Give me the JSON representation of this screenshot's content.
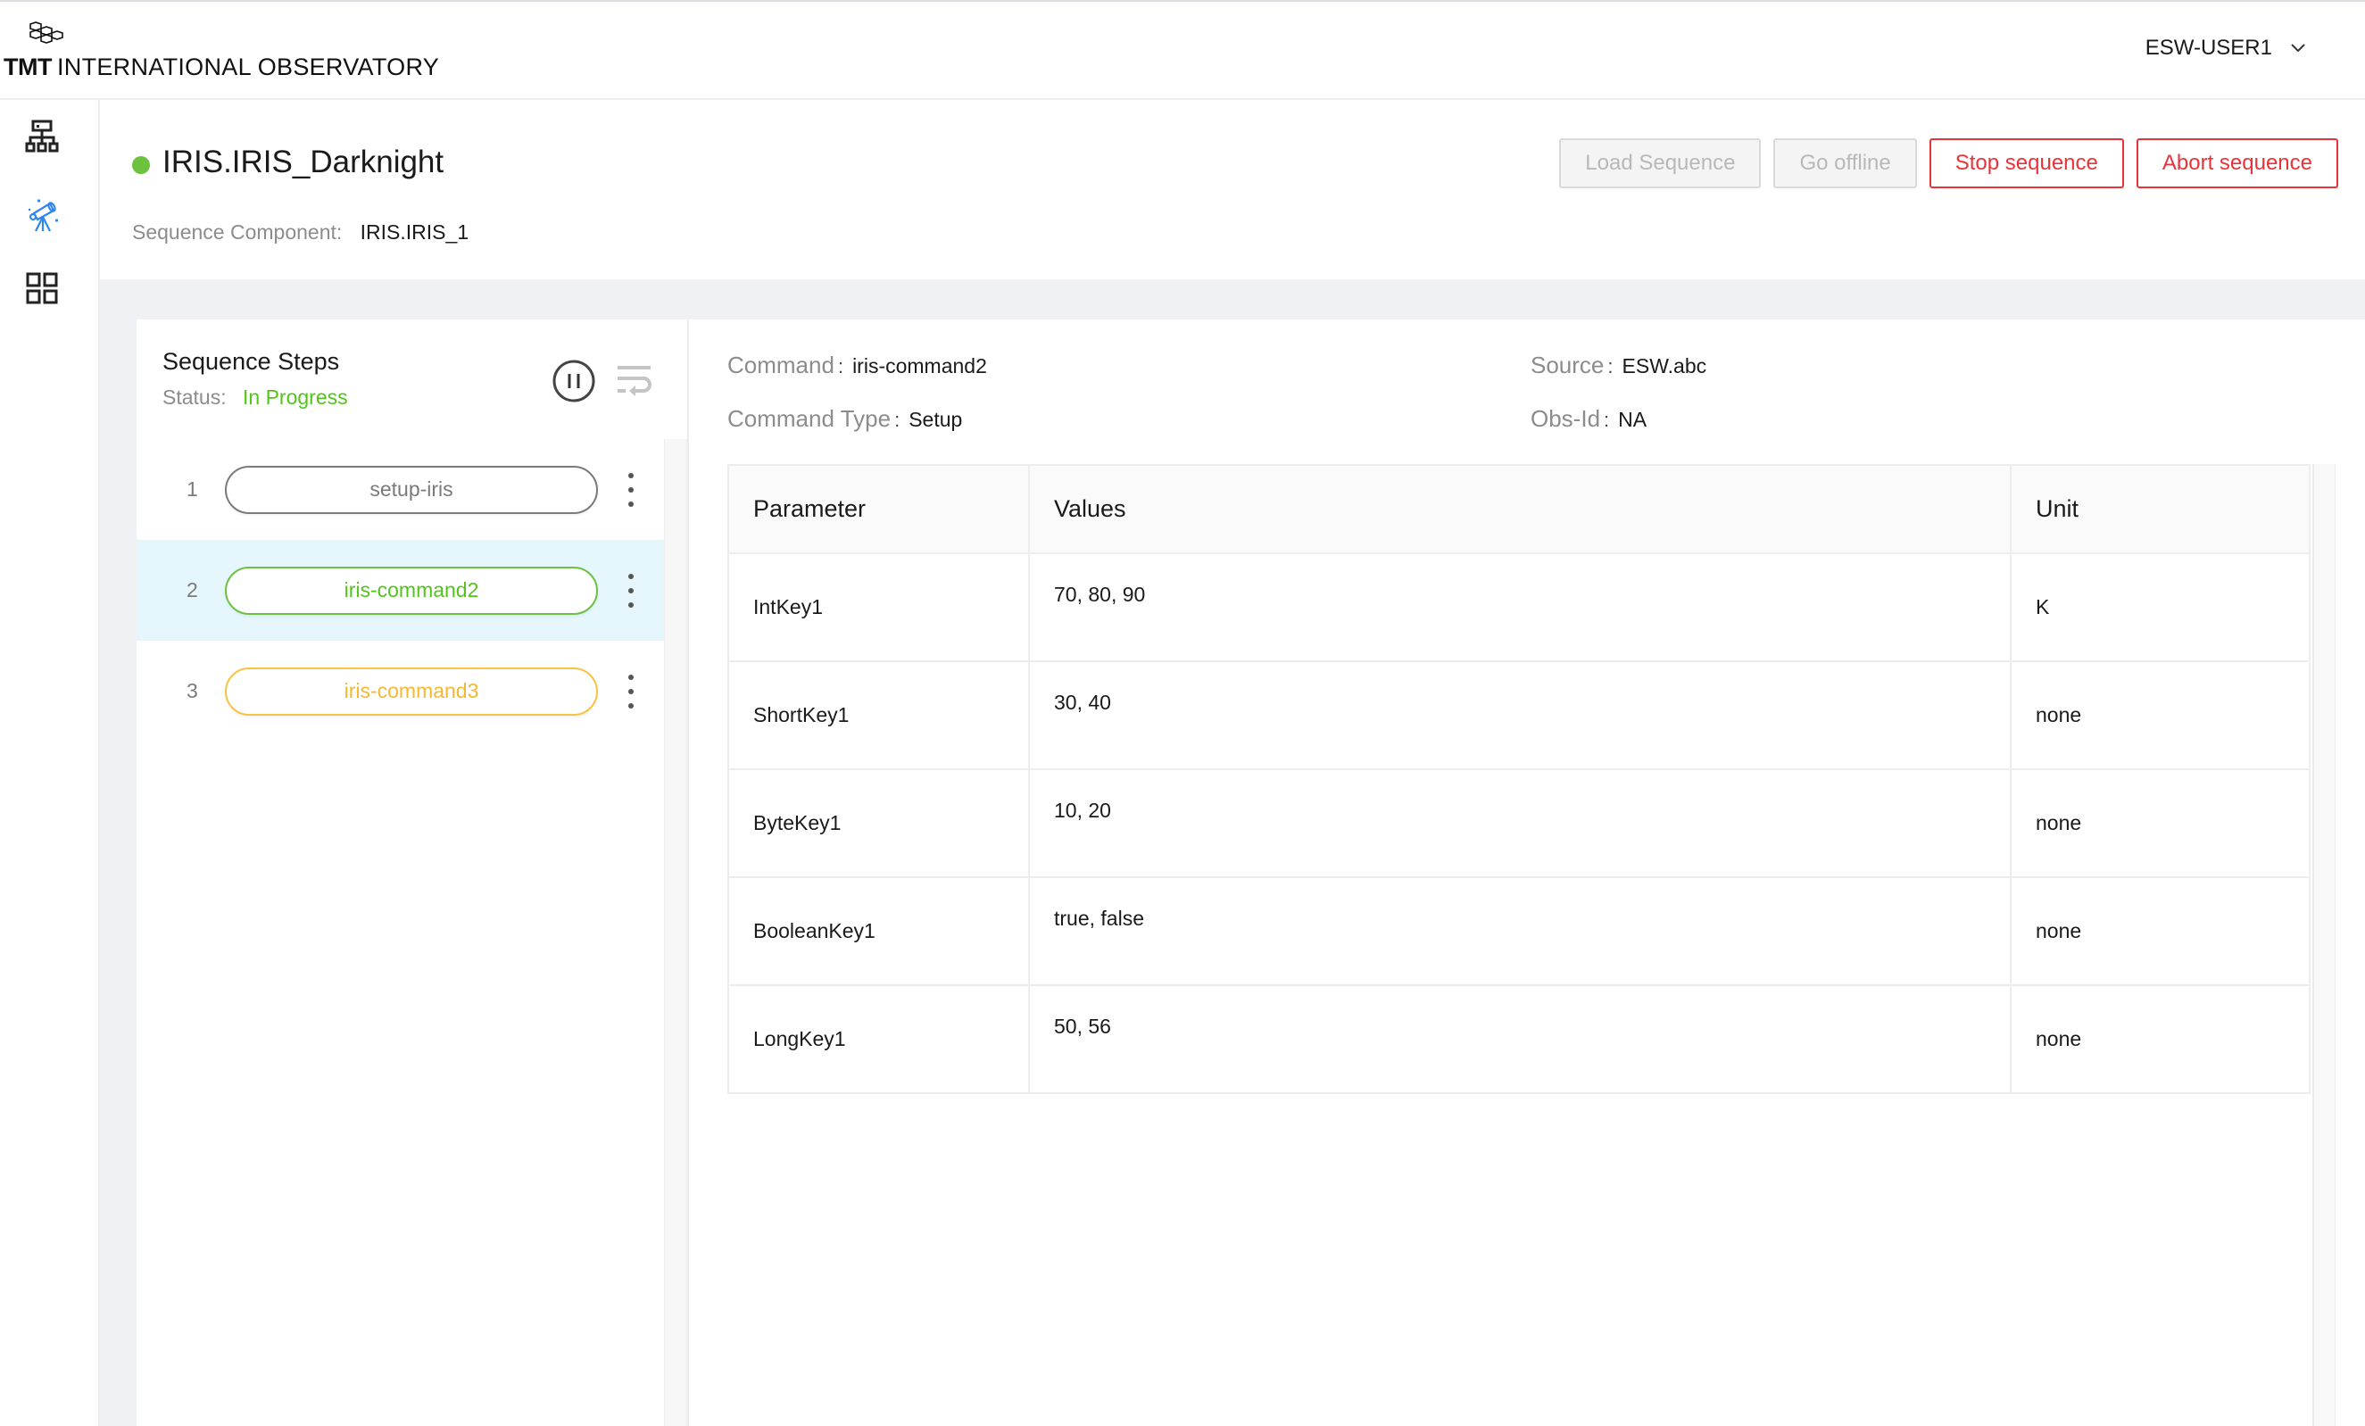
{
  "header": {
    "logo_brand": "TMT",
    "logo_text": "INTERNATIONAL OBSERVATORY",
    "user": "ESW-USER1",
    "user_menu_icon": "chevron-down-icon"
  },
  "sidenav": {
    "items": [
      {
        "name": "infrastructure",
        "icon": "hierarchy-icon",
        "active": false
      },
      {
        "name": "observations",
        "icon": "telescope-icon",
        "active": true
      },
      {
        "name": "apps",
        "icon": "grid-icon",
        "active": false
      }
    ]
  },
  "sequencer": {
    "title": "IRIS.IRIS_Darknight",
    "status_color": "#6cc13f",
    "component_label": "Sequence Component:",
    "component_value": "IRIS.IRIS_1",
    "actions": [
      {
        "label": "Load Sequence",
        "state": "disabled"
      },
      {
        "label": "Go offline",
        "state": "disabled"
      },
      {
        "label": "Stop sequence",
        "state": "danger"
      },
      {
        "label": "Abort sequence",
        "state": "danger"
      }
    ]
  },
  "steps": {
    "title": "Sequence Steps",
    "status_label": "Status:",
    "status_value": "In Progress",
    "status_color": "#52c41a",
    "pause_icon": "pause-circle-icon",
    "reload_icon": "wrap-text-icon",
    "items": [
      {
        "index": "1",
        "name": "setup-iris",
        "state": "finished",
        "color": "#7a7a7a",
        "selected": false
      },
      {
        "index": "2",
        "name": "iris-command2",
        "state": "in-progress",
        "color": "#52c41a",
        "selected": true
      },
      {
        "index": "3",
        "name": "iris-command3",
        "state": "pending",
        "color": "#f5b82e",
        "selected": false
      }
    ]
  },
  "details": {
    "command_label": "Command",
    "command_value": "iris-command2",
    "command_type_label": "Command Type",
    "command_type_value": "Setup",
    "source_label": "Source",
    "source_value": "ESW.abc",
    "obsid_label": "Obs-Id",
    "obsid_value": "NA",
    "separator": ":",
    "table": {
      "columns": [
        "Parameter",
        "Values",
        "Unit"
      ],
      "rows": [
        {
          "parameter": "IntKey1",
          "values": "70, 80, 90",
          "unit": "K"
        },
        {
          "parameter": "ShortKey1",
          "values": "30, 40",
          "unit": "none"
        },
        {
          "parameter": "ByteKey1",
          "values": "10, 20",
          "unit": "none"
        },
        {
          "parameter": "BooleanKey1",
          "values": "true, false",
          "unit": "none"
        },
        {
          "parameter": "LongKey1",
          "values": "50, 56",
          "unit": "none"
        }
      ]
    }
  }
}
